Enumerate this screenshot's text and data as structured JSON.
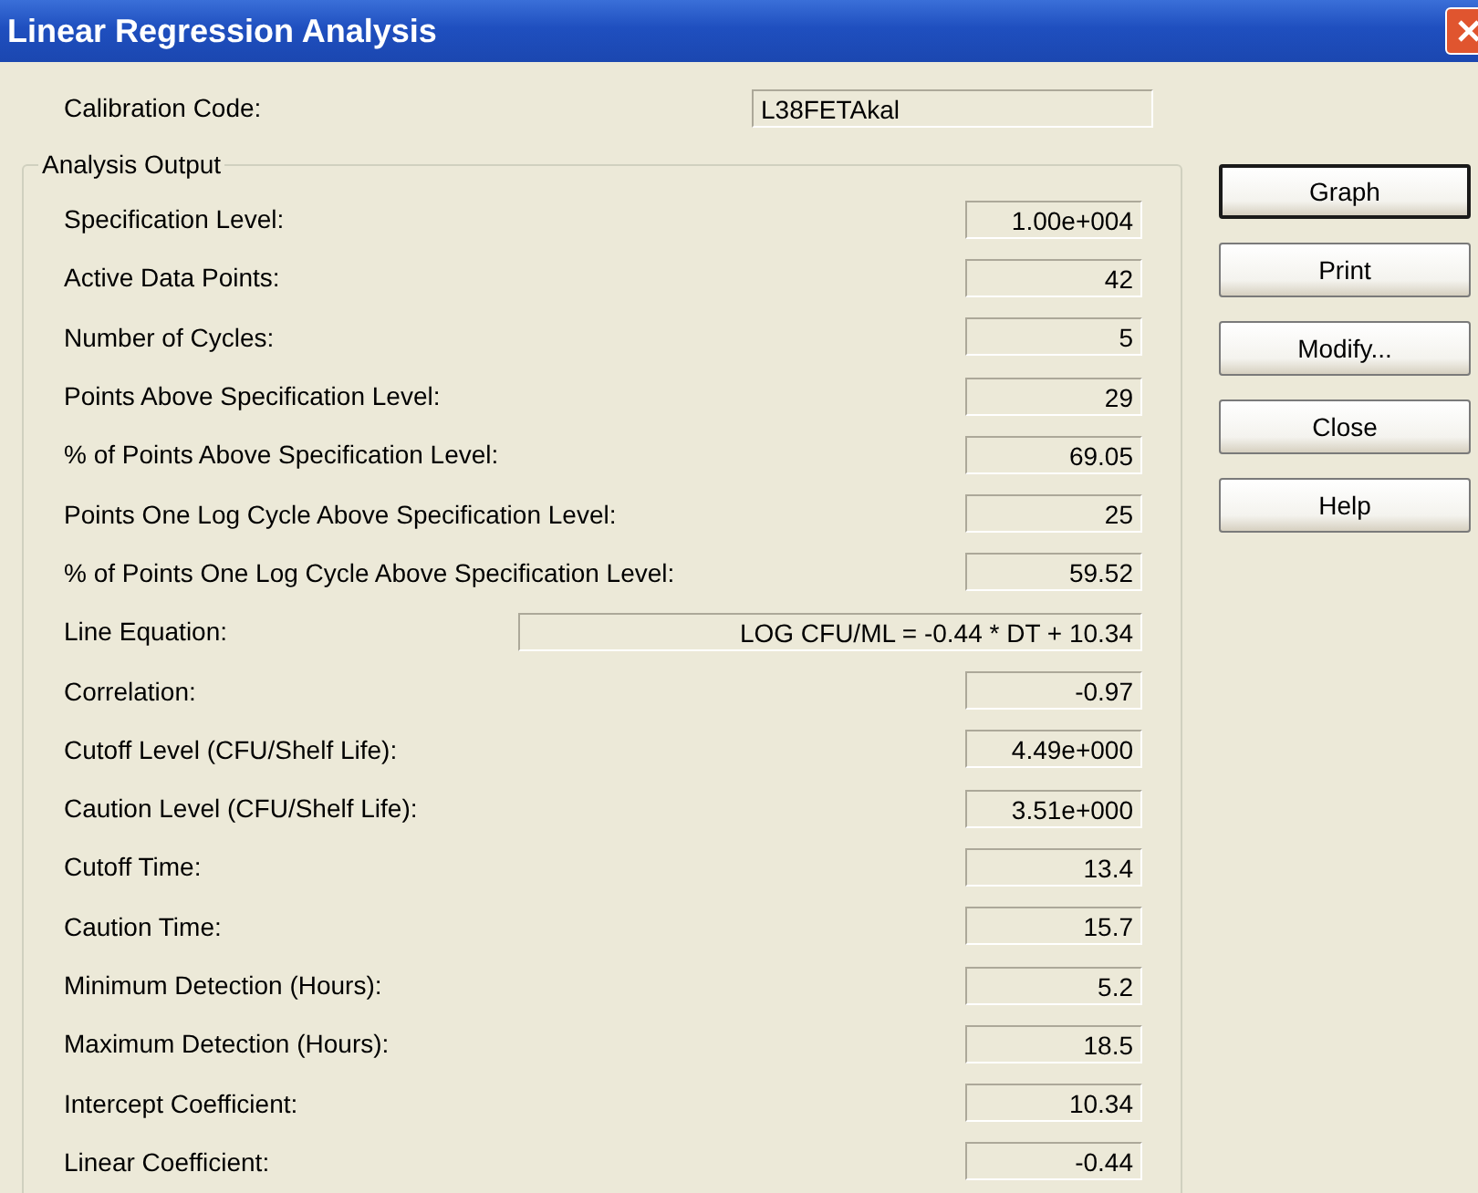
{
  "window": {
    "title": "Linear Regression Analysis"
  },
  "calibration": {
    "label": "Calibration Code:",
    "value": "L38FETAkal"
  },
  "group": {
    "title": "Analysis Output",
    "rows": [
      {
        "label": "Specification Level:",
        "value": "1.00e+004",
        "kind": "value"
      },
      {
        "label": "Active Data Points:",
        "value": "42",
        "kind": "value"
      },
      {
        "label": "Number of Cycles:",
        "value": "5",
        "kind": "value"
      },
      {
        "label": "Points Above Specification Level:",
        "value": "29",
        "kind": "value"
      },
      {
        "label": "% of Points Above Specification Level:",
        "value": "69.05",
        "kind": "value"
      },
      {
        "label": "Points One Log Cycle Above Specification Level:",
        "value": "25",
        "kind": "value"
      },
      {
        "label": "% of Points One Log Cycle Above Specification Level:",
        "value": "59.52",
        "kind": "value"
      },
      {
        "label": "Line Equation:",
        "value": "LOG CFU/ML = -0.44 * DT + 10.34",
        "kind": "wide"
      },
      {
        "label": "Correlation:",
        "value": "-0.97",
        "kind": "value"
      },
      {
        "label": "Cutoff Level (CFU/Shelf Life):",
        "value": "4.49e+000",
        "kind": "value"
      },
      {
        "label": "Caution Level (CFU/Shelf Life):",
        "value": "3.51e+000",
        "kind": "value"
      },
      {
        "label": "Cutoff Time:",
        "value": "13.4",
        "kind": "value"
      },
      {
        "label": "Caution Time:",
        "value": "15.7",
        "kind": "value"
      },
      {
        "label": "Minimum Detection (Hours):",
        "value": "5.2",
        "kind": "value"
      },
      {
        "label": "Maximum Detection (Hours):",
        "value": "18.5",
        "kind": "value"
      },
      {
        "label": "Intercept Coefficient:",
        "value": "10.34",
        "kind": "value"
      },
      {
        "label": "Linear Coefficient:",
        "value": "-0.44",
        "kind": "value"
      }
    ]
  },
  "buttons": [
    {
      "label": "Graph",
      "default": true
    },
    {
      "label": "Print",
      "default": false
    },
    {
      "label": "Modify...",
      "default": false
    },
    {
      "label": "Close",
      "default": false
    },
    {
      "label": "Help",
      "default": false
    }
  ]
}
